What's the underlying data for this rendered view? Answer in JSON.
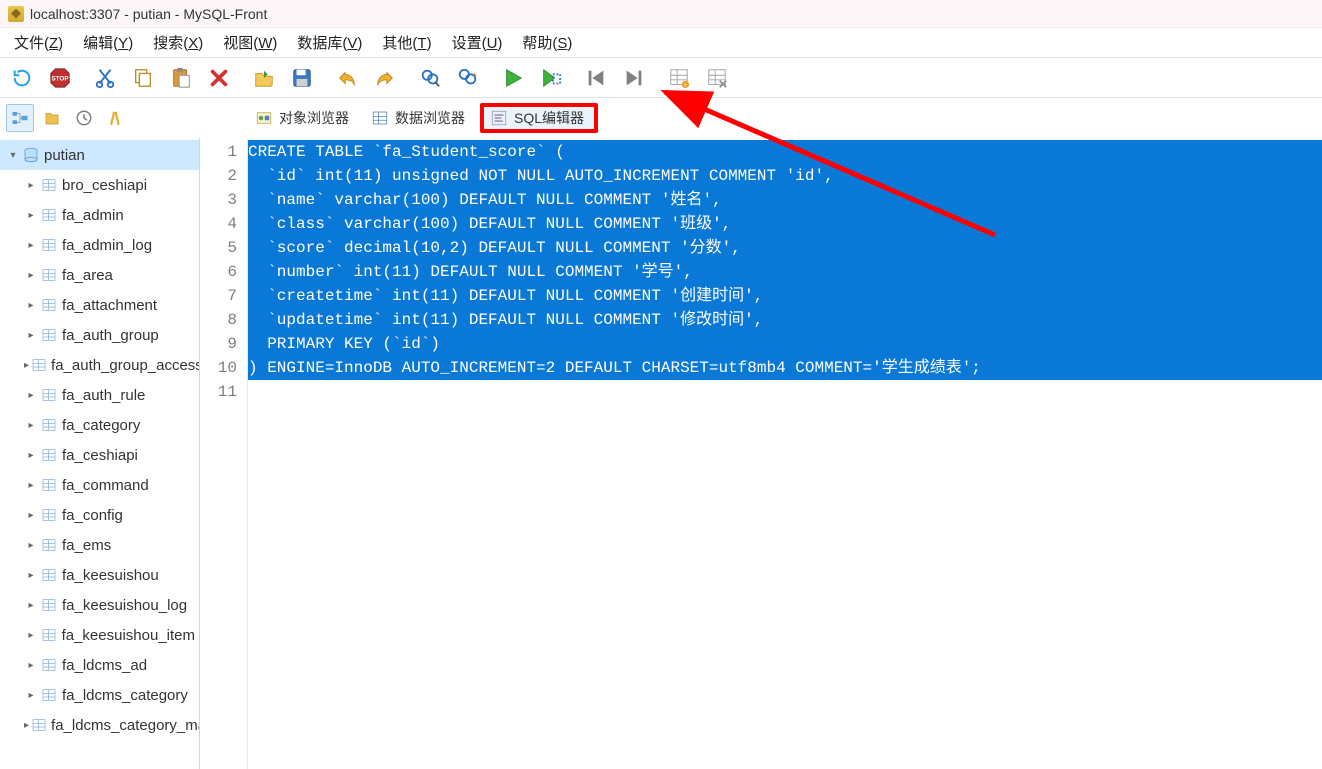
{
  "title": "localhost:3307 - putian - MySQL-Front",
  "menus": [
    {
      "label": "文件",
      "key": "Z"
    },
    {
      "label": "编辑",
      "key": "Y"
    },
    {
      "label": "搜索",
      "key": "X"
    },
    {
      "label": "视图",
      "key": "W"
    },
    {
      "label": "数据库",
      "key": "V"
    },
    {
      "label": "其他",
      "key": "T"
    },
    {
      "label": "设置",
      "key": "U"
    },
    {
      "label": "帮助",
      "key": "S"
    }
  ],
  "view_tabs": {
    "object_browser": "对象浏览器",
    "data_browser": "数据浏览器",
    "sql_editor": "SQL编辑器"
  },
  "db_name": "putian",
  "tables": [
    "bro_ceshiapi",
    "fa_admin",
    "fa_admin_log",
    "fa_area",
    "fa_attachment",
    "fa_auth_group",
    "fa_auth_group_access",
    "fa_auth_rule",
    "fa_category",
    "fa_ceshiapi",
    "fa_command",
    "fa_config",
    "fa_ems",
    "fa_keesuishou",
    "fa_keesuishou_log",
    "fa_keesuishou_item",
    "fa_ldcms_ad",
    "fa_ldcms_category",
    "fa_ldcms_category_map"
  ],
  "sql_lines": [
    "CREATE TABLE `fa_Student_score` (",
    "  `id` int(11) unsigned NOT NULL AUTO_INCREMENT COMMENT 'id',",
    "  `name` varchar(100) DEFAULT NULL COMMENT '姓名',",
    "  `class` varchar(100) DEFAULT NULL COMMENT '班级',",
    "  `score` decimal(10,2) DEFAULT NULL COMMENT '分数',",
    "  `number` int(11) DEFAULT NULL COMMENT '学号',",
    "  `createtime` int(11) DEFAULT NULL COMMENT '创建时间',",
    "  `updatetime` int(11) DEFAULT NULL COMMENT '修改时间',",
    "  PRIMARY KEY (`id`)",
    ") ENGINE=InnoDB AUTO_INCREMENT=2 DEFAULT CHARSET=utf8mb4 COMMENT='学生成绩表';",
    ""
  ],
  "selected_line_count": 10
}
